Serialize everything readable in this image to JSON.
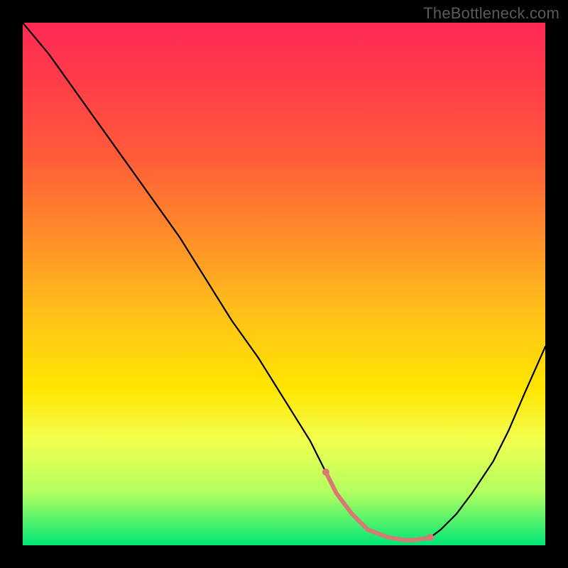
{
  "watermark": "TheBottleneck.com",
  "chart_data": {
    "type": "line",
    "title": "",
    "xlabel": "",
    "ylabel": "",
    "xlim": [
      0,
      100
    ],
    "ylim": [
      0,
      100
    ],
    "series": [
      {
        "name": "bottleneck-curve",
        "x": [
          0,
          5,
          10,
          15,
          20,
          25,
          30,
          35,
          40,
          45,
          50,
          55,
          58,
          60,
          63,
          66,
          70,
          73,
          75,
          78,
          80,
          83,
          86,
          90,
          93,
          96,
          100
        ],
        "y": [
          100,
          94,
          87,
          80,
          73,
          66,
          59,
          51,
          43,
          36,
          28,
          20,
          14,
          10,
          6,
          3,
          1.5,
          1,
          1,
          1.5,
          3,
          6,
          10,
          16,
          22,
          29,
          38
        ]
      }
    ],
    "good_zone": {
      "name": "optimal-band",
      "x": [
        58,
        78
      ],
      "y": [
        3,
        3
      ],
      "color": "#d87a73",
      "thickness": 6
    }
  },
  "colors": {
    "curve": "#000000",
    "frame": "#000000",
    "gradient_top": "#ff2a55",
    "gradient_bottom": "#00e676"
  }
}
